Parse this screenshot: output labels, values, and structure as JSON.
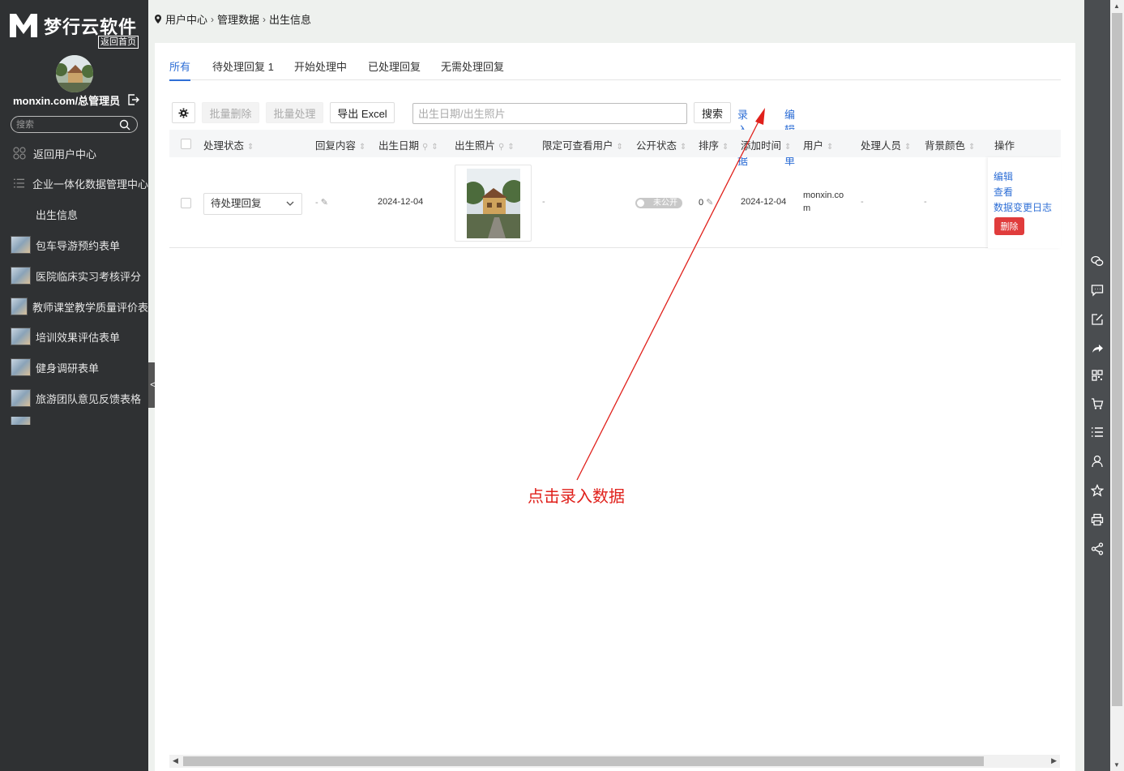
{
  "sidebar": {
    "brand": "梦行云软件",
    "home_link": "返回首页",
    "user_label": "monxin.com/总管理员",
    "search_placeholder": "搜索",
    "items": [
      {
        "label": "返回用户中心",
        "icon": "grid-icon"
      },
      {
        "label": "企业一体化数据管理中心",
        "icon": "list-icon"
      },
      {
        "label": "出生信息",
        "icon": ""
      },
      {
        "label": "包车导游预约表单",
        "icon": "thumbnail"
      },
      {
        "label": "医院临床实习考核评分",
        "icon": "thumbnail"
      },
      {
        "label": "教师课堂教学质量评价表",
        "icon": "thumbnail"
      },
      {
        "label": "培训效果评估表单",
        "icon": "thumbnail"
      },
      {
        "label": "健身调研表单",
        "icon": "thumbnail"
      },
      {
        "label": "旅游团队意见反馈表格",
        "icon": "thumbnail"
      }
    ],
    "collapse_label": "<"
  },
  "breadcrumb": [
    "用户中心",
    "管理数据",
    "出生信息"
  ],
  "tabs": [
    {
      "label": "所有",
      "active": true
    },
    {
      "label": "待处理回复 1",
      "active": false
    },
    {
      "label": "开始处理中",
      "active": false
    },
    {
      "label": "已处理回复",
      "active": false
    },
    {
      "label": "无需处理回复",
      "active": false
    }
  ],
  "toolbar": {
    "batch_delete": "批量删除",
    "batch_process": "批量处理",
    "export_excel": "导出 Excel",
    "search_placeholder": "出生日期/出生照片",
    "search_button": "搜索",
    "add_data": "录入数据",
    "edit_form": "编辑表单"
  },
  "table": {
    "columns": [
      "处理状态",
      "回复内容",
      "出生日期",
      "出生照片",
      "限定可查看用户",
      "公开状态",
      "排序",
      "添加时间",
      "用户",
      "处理人员",
      "背景颜色",
      "操作"
    ],
    "rows": [
      {
        "status": "待处理回复",
        "reply": "-",
        "birth_date": "2024-12-04",
        "restricted_users": "-",
        "public_state": "未公开",
        "sort": "0",
        "added": "2024-12-04",
        "user_line1": "monxin.co",
        "user_line2": "m",
        "handler": "-",
        "bg_color": "-",
        "actions": {
          "edit": "编辑",
          "view": "查看",
          "log": "数据变更日志",
          "delete": "删除"
        }
      }
    ]
  },
  "annotation": {
    "text": "点击录入数据",
    "color": "#e0201b"
  },
  "colors": {
    "accent": "#2f6fd6",
    "danger": "#e03c3c",
    "sidebar_bg": "#2f3133"
  }
}
